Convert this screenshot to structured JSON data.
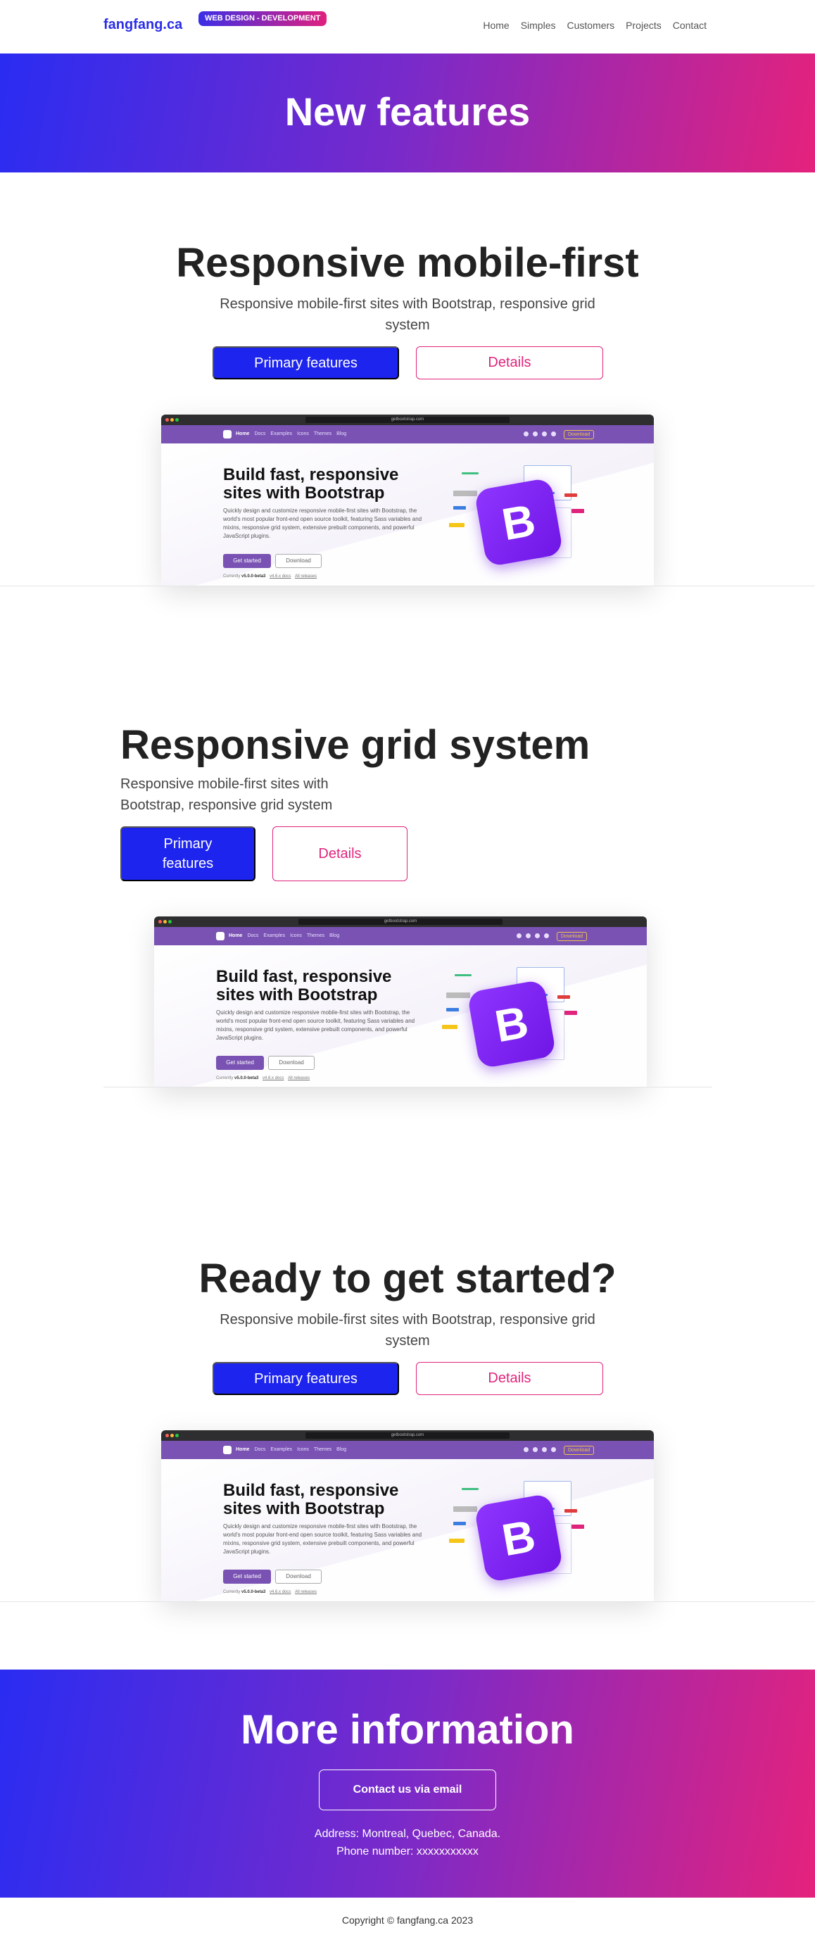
{
  "navbar": {
    "brand": "fangfang.ca",
    "badge": "WEB DESIGN - DEVELOPMENT",
    "links": [
      "Home",
      "Simples",
      "Customers",
      "Projects",
      "Contact"
    ]
  },
  "hero": {
    "title": "New features"
  },
  "sections": [
    {
      "title": "Responsive mobile-first",
      "subtitle": "Responsive mobile-first sites with Bootstrap, responsive grid system",
      "primary_label": "Primary features",
      "details_label": "Details"
    },
    {
      "title": "Responsive grid system",
      "subtitle": "Responsive mobile-first sites with Bootstrap, responsive grid system",
      "primary_label": "Primary features",
      "details_label": "Details"
    },
    {
      "title": "Ready to get started?",
      "subtitle": "Responsive mobile-first sites with Bootstrap, responsive grid system",
      "primary_label": "Primary features",
      "details_label": "Details"
    }
  ],
  "mock": {
    "url": "getbootstrap.com",
    "nav_links": [
      "Home",
      "Docs",
      "Examples",
      "Icons",
      "Themes",
      "Blog"
    ],
    "download_btn": "Download",
    "heading": "Build fast, responsive sites with Bootstrap",
    "paragraph": "Quickly design and customize responsive mobile-first sites with Bootstrap, the world's most popular front-end open source toolkit, featuring Sass variables and mixins, responsive grid system, extensive prebuilt components, and powerful JavaScript plugins.",
    "get_started": "Get started",
    "download": "Download",
    "currently_prefix": "Currently",
    "version": "v5.0.0-beta3",
    "docs_link": "v4.6.x docs",
    "releases_link": "All releases",
    "logo_letter": "B"
  },
  "info": {
    "title": "More information",
    "contact_button": "Contact us via email",
    "address": "Address: Montreal, Quebec, Canada.",
    "phone": "Phone number: xxxxxxxxxxx"
  },
  "footer": {
    "copyright": "Copyright © fangfang.ca 2023"
  },
  "colors": {
    "brand": "#2b2ee6",
    "primary_button": "#1d24ee",
    "accent_pink": "#e0247c",
    "gradient_start": "#2a2cf2",
    "gradient_end": "#e5227c",
    "bootstrap_purple": "#7952b3"
  }
}
